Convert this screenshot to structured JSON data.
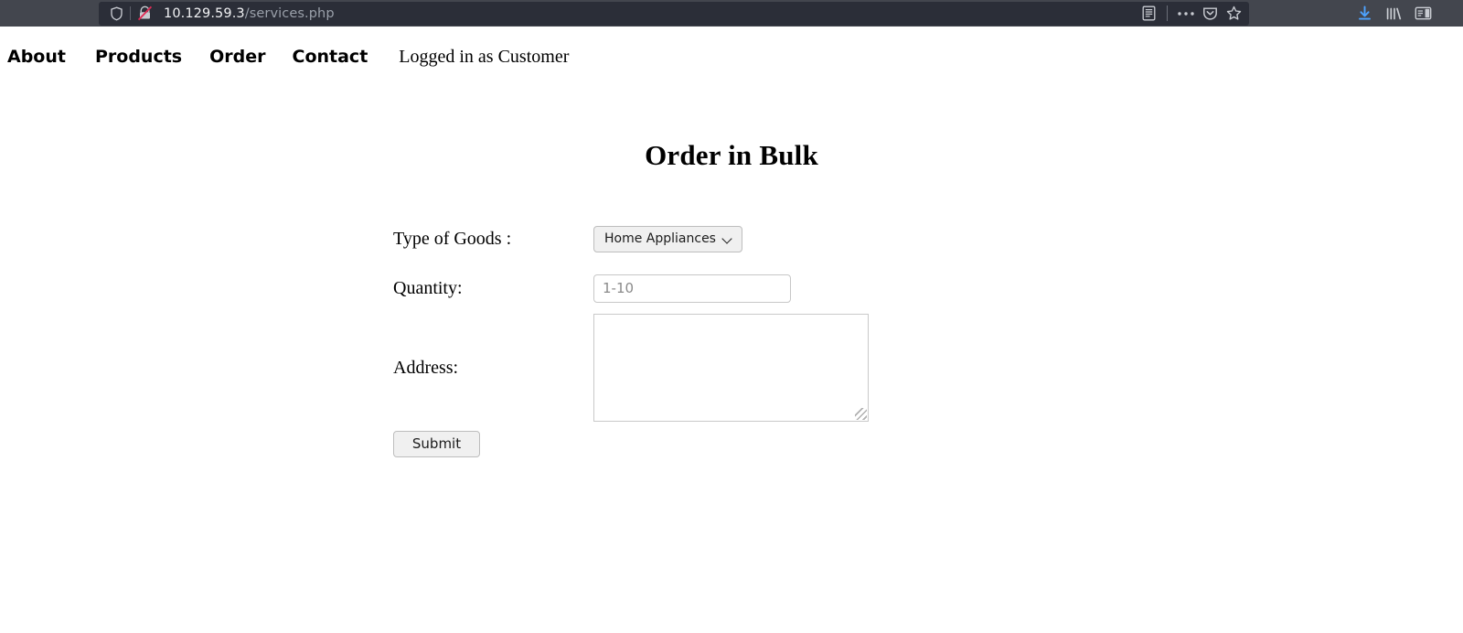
{
  "browser": {
    "url_host": "10.129.59.3",
    "url_path": "/services.php",
    "identity_icons": [
      {
        "name": "shield-icon",
        "title": "tracking-protection"
      },
      {
        "name": "insecure-connection-icon",
        "title": "lock-crossed-out"
      }
    ],
    "urlbar_right_icons": [
      {
        "name": "reader-mode-icon"
      },
      {
        "name": "page-actions-icon"
      },
      {
        "name": "pocket-icon"
      },
      {
        "name": "bookmark-star-icon"
      }
    ],
    "toolbar_right_icons": [
      {
        "name": "downloads-icon",
        "color": "#4da3ff"
      },
      {
        "name": "library-icon"
      },
      {
        "name": "sidebar-icon"
      }
    ],
    "colors": {
      "toolbar_bg": "#43464e",
      "urlbar_bg": "#2b2e38",
      "url_host_text": "#f2f3f5",
      "url_path_text": "#9aa0aa",
      "download_accent": "#4da3ff"
    }
  },
  "nav": {
    "links": [
      {
        "label": "About"
      },
      {
        "label": "Products"
      },
      {
        "label": "Order"
      },
      {
        "label": "Contact"
      }
    ],
    "status": "Logged in as Customer"
  },
  "main": {
    "title": "Order in Bulk",
    "form": {
      "goods": {
        "label": "Type of Goods :",
        "selected": "Home Appliances"
      },
      "quantity": {
        "label": "Quantity:",
        "value": "",
        "placeholder": "1-10"
      },
      "address": {
        "label": "Address:",
        "value": "",
        "placeholder": ""
      },
      "submit_label": "Submit"
    }
  }
}
